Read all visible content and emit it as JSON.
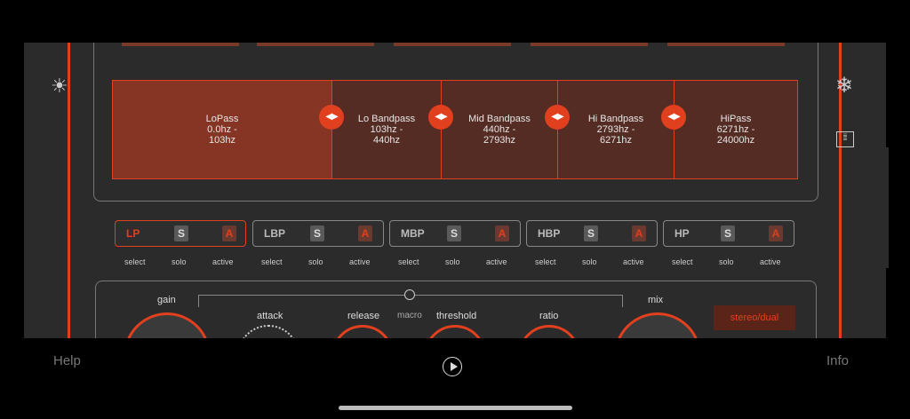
{
  "bands": [
    {
      "name": "LoPass",
      "range_line1": "0.0hz -",
      "range_line2": "103hz"
    },
    {
      "name": "Lo Bandpass",
      "range_line1": "103hz -",
      "range_line2": "440hz"
    },
    {
      "name": "Mid Bandpass",
      "range_line1": "440hz -",
      "range_line2": "2793hz"
    },
    {
      "name": "Hi Bandpass",
      "range_line1": "2793hz -",
      "range_line2": "6271hz"
    },
    {
      "name": "HiPass",
      "range_line1": "6271hz -",
      "range_line2": "24000hz"
    }
  ],
  "selectors": [
    {
      "name": "LP",
      "solo": "S",
      "active": "A"
    },
    {
      "name": "LBP",
      "solo": "S",
      "active": "A"
    },
    {
      "name": "MBP",
      "solo": "S",
      "active": "A"
    },
    {
      "name": "HBP",
      "solo": "S",
      "active": "A"
    },
    {
      "name": "HP",
      "solo": "S",
      "active": "A"
    }
  ],
  "selector_labels": {
    "select": "select",
    "solo": "solo",
    "active": "active"
  },
  "controls": {
    "gain": "gain",
    "attack": "attack",
    "release": "release",
    "macro": "macro",
    "threshold": "threshold",
    "ratio": "ratio",
    "mix": "mix",
    "mode_button": "stereo/dual"
  },
  "footer": {
    "help": "Help",
    "info": "Info"
  },
  "icons": {
    "settings": "sun-icon",
    "freeze": "snowflake-icon",
    "list": "list-icon",
    "play": "play-icon"
  },
  "colors": {
    "accent": "#e0401e",
    "panel": "#2b2b2b"
  }
}
